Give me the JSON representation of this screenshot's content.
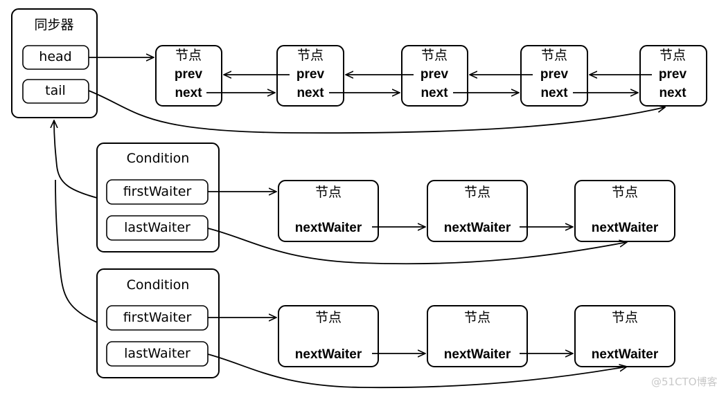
{
  "synchronizer": {
    "title": "同步器",
    "fields": [
      {
        "label": "head"
      },
      {
        "label": "tail"
      }
    ]
  },
  "sync_queue": {
    "nodes": [
      {
        "title": "节点",
        "prev": "prev",
        "next": "next"
      },
      {
        "title": "节点",
        "prev": "prev",
        "next": "next"
      },
      {
        "title": "节点",
        "prev": "prev",
        "next": "next"
      },
      {
        "title": "节点",
        "prev": "prev",
        "next": "next"
      },
      {
        "title": "节点",
        "prev": "prev",
        "next": "next"
      }
    ]
  },
  "conditions": [
    {
      "title": "Condition",
      "first_label": "firstWaiter",
      "last_label": "lastWaiter",
      "nodes": [
        {
          "title": "节点",
          "field": "nextWaiter"
        },
        {
          "title": "节点",
          "field": "nextWaiter"
        },
        {
          "title": "节点",
          "field": "nextWaiter"
        }
      ]
    },
    {
      "title": "Condition",
      "first_label": "firstWaiter",
      "last_label": "lastWaiter",
      "nodes": [
        {
          "title": "节点",
          "field": "nextWaiter"
        },
        {
          "title": "节点",
          "field": "nextWaiter"
        },
        {
          "title": "节点",
          "field": "nextWaiter"
        }
      ]
    }
  ],
  "watermark": "@51CTO博客"
}
